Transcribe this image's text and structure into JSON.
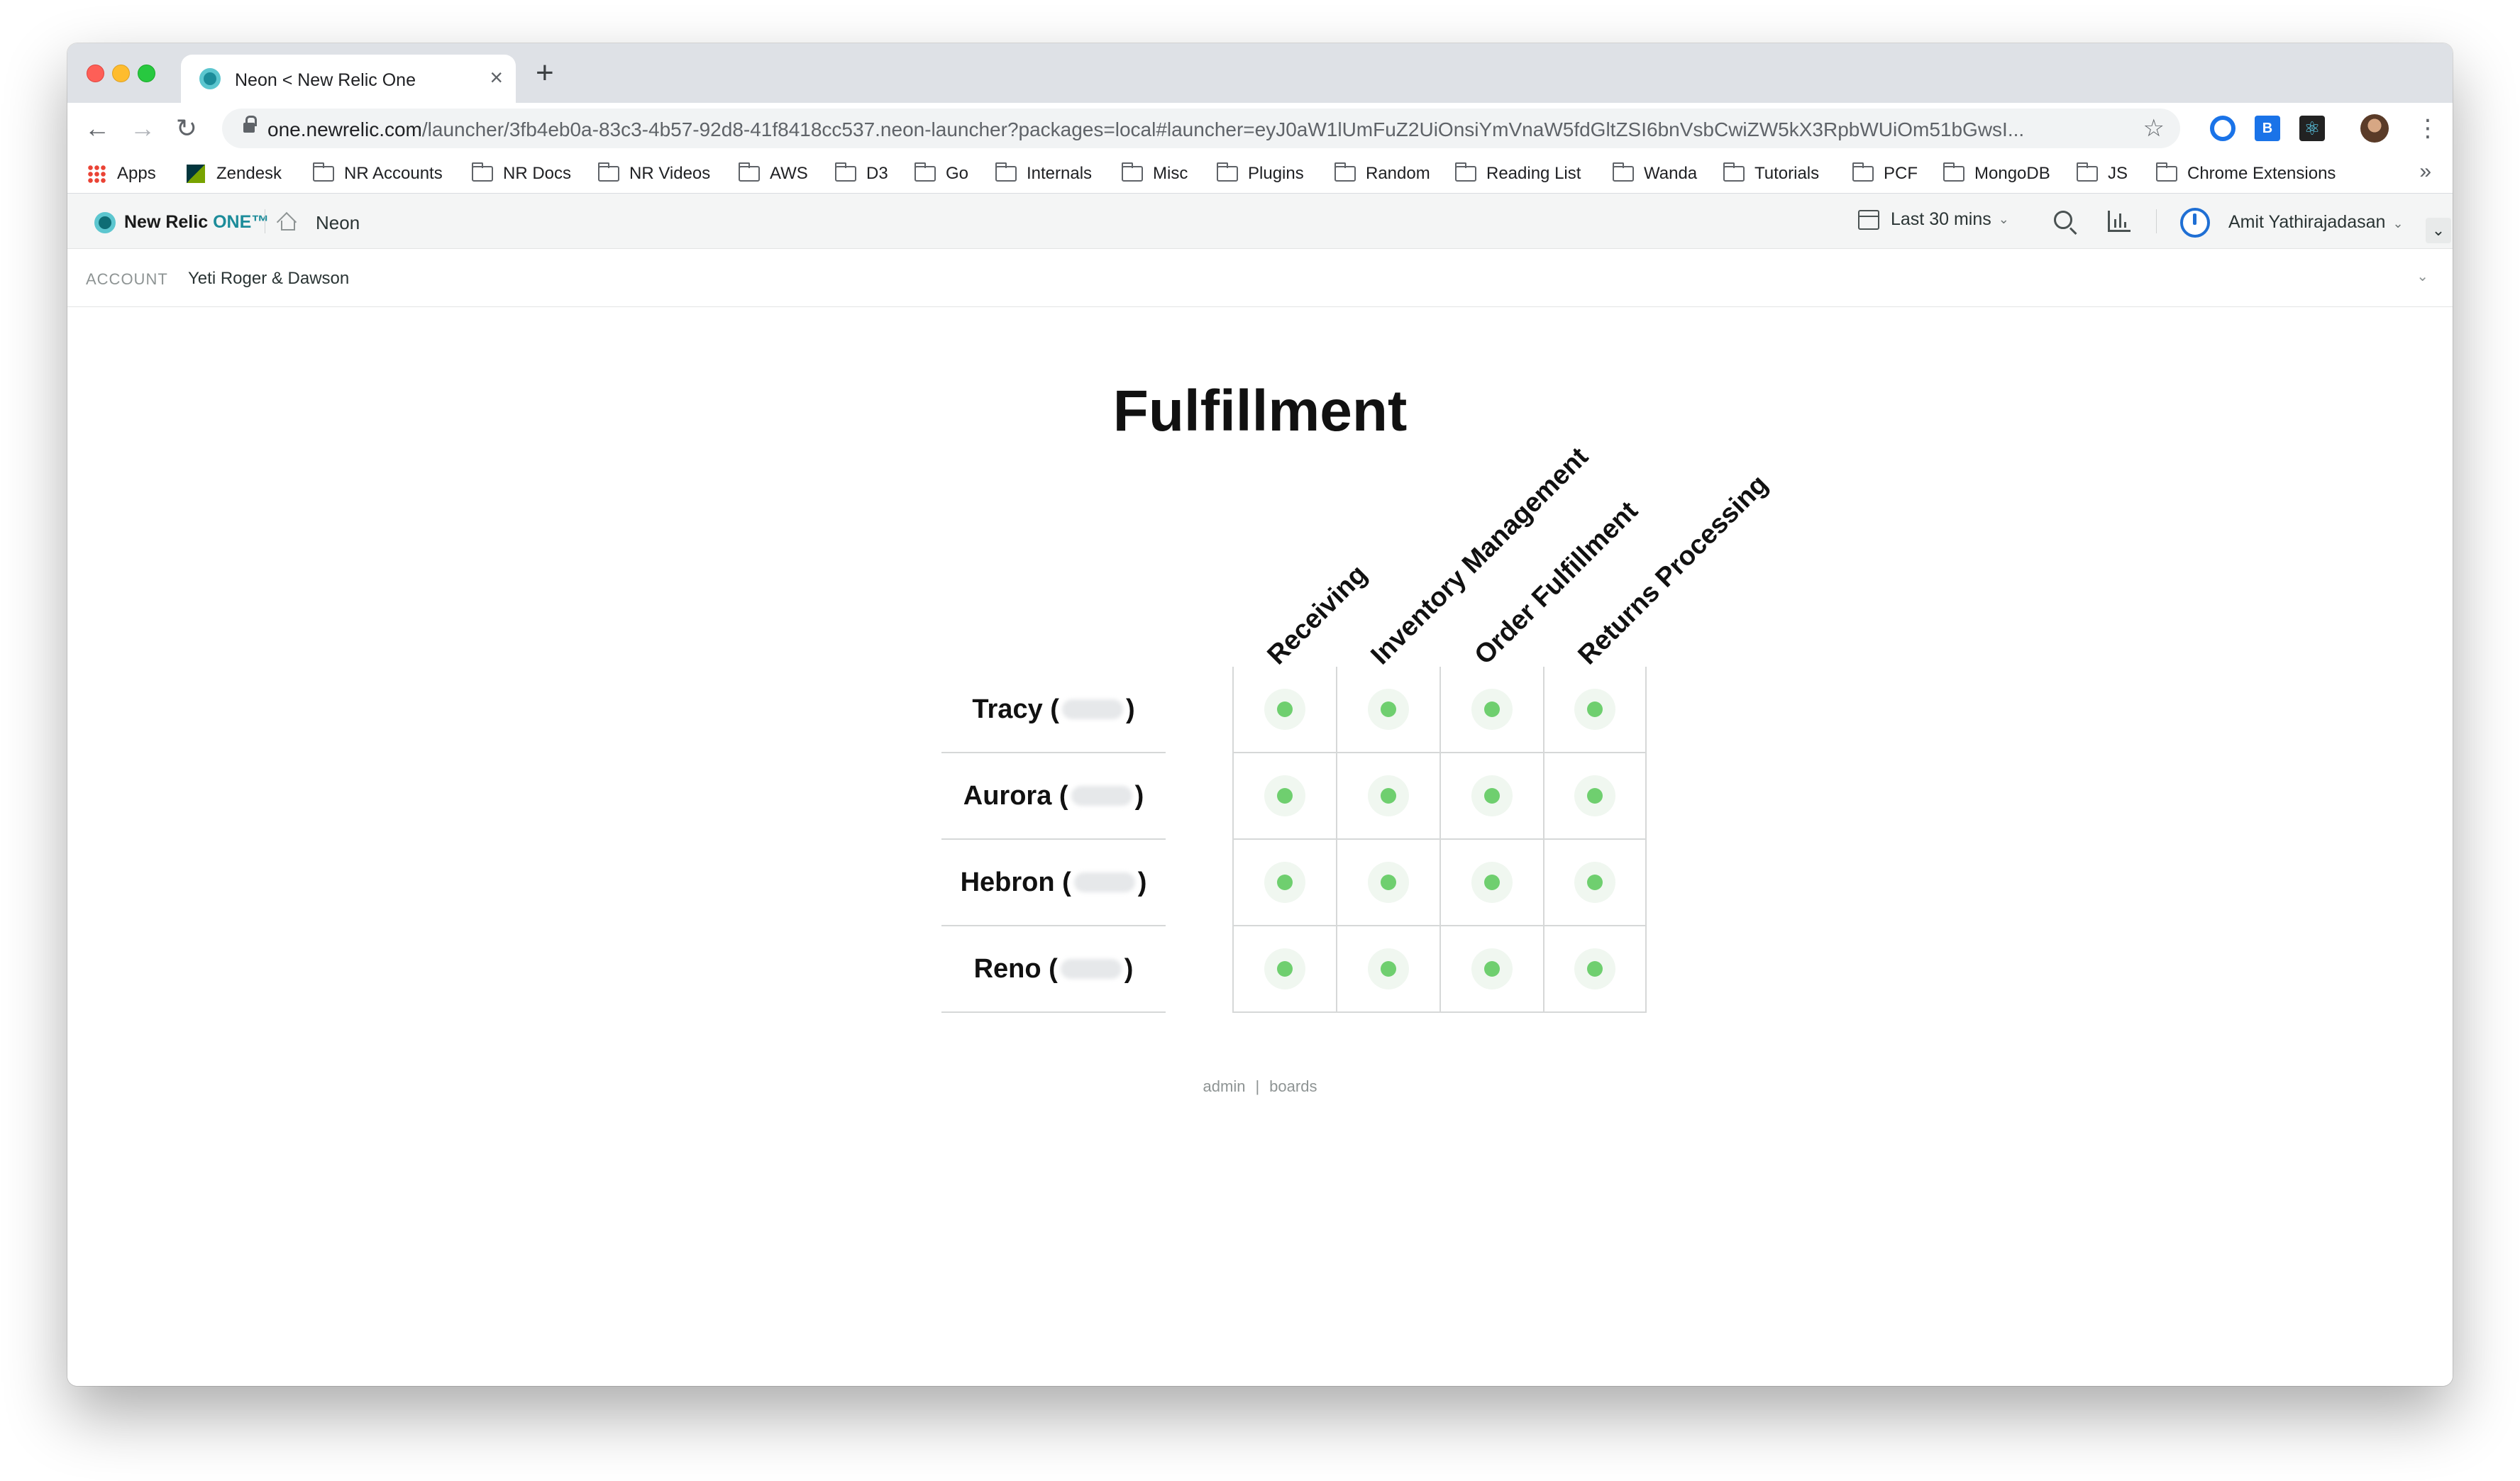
{
  "browser": {
    "tab_title": "Neon < New Relic One",
    "url_host": "one.newrelic.com",
    "url_path": "/launcher/3fb4eb0a-83c3-4b57-92d8-41f8418cc537.neon-launcher?packages=local#launcher=eyJ0aW1lUmFuZ2UiOnsiYmVnaW5fdGltZSI6bnVsbCwiZW5kX3RpbWUiOm51bGwsI...",
    "bookmarks": [
      "Apps",
      "Zendesk",
      "NR Accounts",
      "NR Docs",
      "NR Videos",
      "AWS",
      "D3",
      "Go",
      "Internals",
      "Misc",
      "Plugins",
      "Random",
      "Reading List",
      "Wanda",
      "Tutorials",
      "PCF",
      "MongoDB",
      "JS",
      "Chrome Extensions"
    ],
    "more": "»"
  },
  "nr_header": {
    "logo_text": "New Relic",
    "logo_one": "ONE™",
    "breadcrumb": "Neon",
    "time_range": "Last 30 mins",
    "user_name": "Amit Yathirajadasan"
  },
  "account": {
    "label": "ACCOUNT",
    "value": "Yeti Roger & Dawson"
  },
  "board": {
    "title": "Fulfillment",
    "columns": [
      "Receiving",
      "Inventory Management",
      "Order Fulfillment",
      "Returns Processing"
    ],
    "rows": [
      {
        "name": "Tracy",
        "open": "(",
        "close": ")"
      },
      {
        "name": "Aurora",
        "open": "(",
        "close": ")"
      },
      {
        "name": "Hebron",
        "open": "(",
        "close": ")"
      },
      {
        "name": "Reno",
        "open": "(",
        "close": ")"
      }
    ],
    "status_color": "#6fcf6f"
  },
  "footer": {
    "admin": "admin",
    "separator": "|",
    "boards": "boards"
  }
}
